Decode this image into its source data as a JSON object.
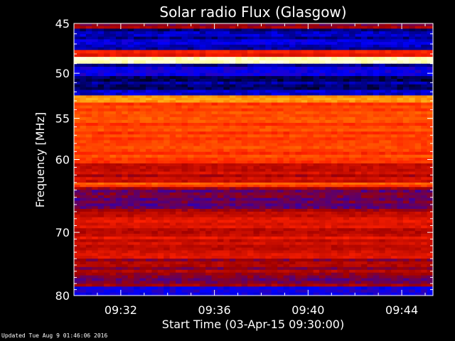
{
  "chart_data": {
    "type": "heatmap",
    "title": "Solar radio Flux (Glasgow)",
    "xlabel": "Start Time (03-Apr-15 09:30:00)",
    "ylabel": "Frequency [MHz]",
    "x_unit": "time (HH:MM)",
    "xlim": [
      "09:30:00",
      "09:45:20"
    ],
    "ylim": [
      45,
      80
    ],
    "y_scale": "log",
    "y_direction": "increasing downward",
    "x_ticks": [
      "09:32",
      "09:36",
      "09:40",
      "09:44"
    ],
    "y_ticks": [
      45,
      50,
      55,
      60,
      70,
      80
    ],
    "colormap": [
      "#000000",
      "#0000ff",
      "#a00000",
      "#ff2000",
      "#ff8000",
      "#ffff40",
      "#ffffff"
    ],
    "bands": [
      {
        "from_mhz": 45.0,
        "to_mhz": 45.5,
        "level": 0.35
      },
      {
        "from_mhz": 45.5,
        "to_mhz": 47.6,
        "level": 0.12
      },
      {
        "from_mhz": 47.6,
        "to_mhz": 48.3,
        "level": 0.45
      },
      {
        "from_mhz": 48.3,
        "to_mhz": 49.0,
        "level": 0.97
      },
      {
        "from_mhz": 49.0,
        "to_mhz": 50.3,
        "level": 0.14
      },
      {
        "from_mhz": 50.3,
        "to_mhz": 52.4,
        "level": 0.1
      },
      {
        "from_mhz": 52.4,
        "to_mhz": 53.2,
        "level": 0.72
      },
      {
        "from_mhz": 53.2,
        "to_mhz": 60.5,
        "level": 0.55
      },
      {
        "from_mhz": 60.5,
        "to_mhz": 63.0,
        "level": 0.4
      },
      {
        "from_mhz": 63.0,
        "to_mhz": 63.6,
        "level": 0.58
      },
      {
        "from_mhz": 63.6,
        "to_mhz": 67.0,
        "level": 0.3
      },
      {
        "from_mhz": 67.0,
        "to_mhz": 74.0,
        "level": 0.42
      },
      {
        "from_mhz": 74.0,
        "to_mhz": 78.5,
        "level": 0.32
      },
      {
        "from_mhz": 78.5,
        "to_mhz": 80.0,
        "level": 0.16
      }
    ]
  },
  "footer": "Updated Tue Aug  9 01:46:06 2016"
}
